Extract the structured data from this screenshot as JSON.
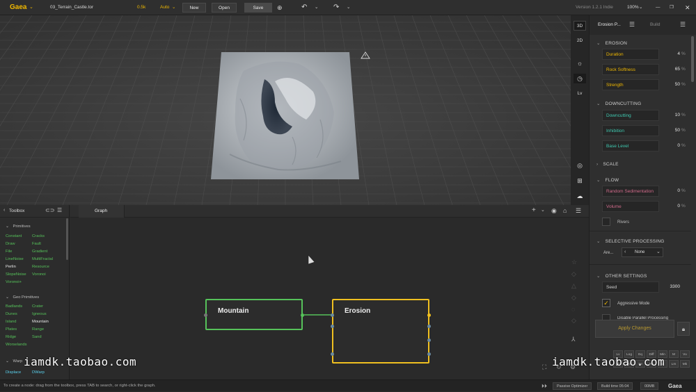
{
  "topbar": {
    "app_name": "Gaea",
    "file_name": "03_Terrain_Castle.tor",
    "resolution": "0.5k",
    "build_mode": "Auto",
    "new_label": "New",
    "open_label": "Open",
    "save_label": "Save",
    "version": "Version 1.2.1 Indie",
    "zoom": "100%"
  },
  "viewport_tools": {
    "view_3d": "3D",
    "view_2d": "2D",
    "lv": "Lv"
  },
  "right_panel": {
    "tab_node": "Erosion P...",
    "tab_build": "Build",
    "erosion": {
      "title": "EROSION",
      "params": [
        {
          "label": "Duration",
          "value": "4",
          "unit": "%"
        },
        {
          "label": "Rock Softness",
          "value": "65",
          "unit": "%"
        },
        {
          "label": "Strength",
          "value": "50",
          "unit": "%"
        }
      ]
    },
    "downcutting": {
      "title": "DOWNCUTTING",
      "params": [
        {
          "label": "Downcutting",
          "value": "10",
          "unit": "%"
        },
        {
          "label": "Inhibition",
          "value": "50",
          "unit": "%"
        },
        {
          "label": "Base Level",
          "value": "0",
          "unit": "%"
        }
      ]
    },
    "scale": {
      "title": "SCALE"
    },
    "flow": {
      "title": "FLOW",
      "params": [
        {
          "label": "Random Sedimentation",
          "value": "0",
          "unit": "%"
        },
        {
          "label": "Volume",
          "value": "0",
          "unit": "%"
        }
      ],
      "rivers_label": "Rivers"
    },
    "selective": {
      "title": "SELECTIVE PROCESSING",
      "area_label": "Are...",
      "area_value": "None"
    },
    "other": {
      "title": "OTHER SETTINGS",
      "seed_label": "Seed",
      "seed_value": "3300",
      "aggressive_label": "Aggressive Mode",
      "disable_label": "Disable Parallel Processing"
    },
    "apply_label": "Apply Changes",
    "mini_buttons": [
      "Lv",
      "Log",
      "Eq",
      "Diff",
      "Min",
      "M",
      "Vu",
      "Sh",
      "N",
      "Se",
      "Rn",
      "Vi",
      "Lm",
      "Mk"
    ]
  },
  "toolbox": {
    "title": "Toolbox",
    "primitives_title": "Primitives",
    "primitives": [
      "Constant",
      "Cracks",
      "Draw",
      "Fault",
      "File",
      "Gradient",
      "LineNoise",
      "MultiFractal",
      "Perlin",
      "Resource",
      "SlopeNoise",
      "Voronoi",
      "Voronoi+"
    ],
    "geo_title": "Geo Primitives",
    "geo": [
      "Badlands",
      "Crater",
      "Dunes",
      "Igneous",
      "Island",
      "Mountain",
      "Plates",
      "Range",
      "Ridge",
      "Sand",
      "Worselands"
    ],
    "warp_title": "Warp",
    "warp": [
      "Displace",
      "DWarp"
    ]
  },
  "graph": {
    "tab_label": "Graph",
    "node_mountain": "Mountain",
    "node_erosion": "Erosion"
  },
  "status": {
    "hint": "To create a node: drag from the toolbox, press TAB to search, or right-click the graph.",
    "optimizer": "Passive Optimizer",
    "build_time": "Build time 05:04",
    "memory": "00MB",
    "brand": "Gaea"
  },
  "watermark": "iamdk.taobao.com",
  "colors": {
    "accent": "#f0b800",
    "green": "#56c25a",
    "node_yellow": "#f0c020",
    "pink": "#d06a8a",
    "cyan": "#3fc9b0"
  }
}
